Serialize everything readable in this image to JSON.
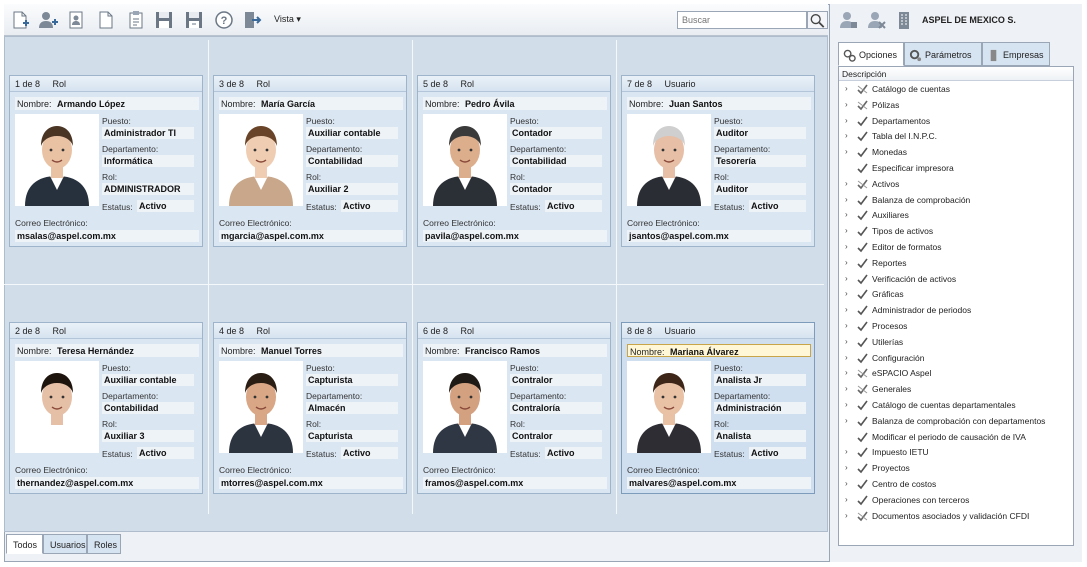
{
  "toolbar": {
    "icons": [
      "new-record-icon",
      "add-user-icon",
      "user-profile-icon",
      "blank-document-icon",
      "clipboard-icon",
      "save-icon",
      "save-as-icon",
      "help-icon",
      "exit-icon"
    ],
    "vista_label": "Vista",
    "search_placeholder": "Buscar"
  },
  "cards": [
    {
      "index": "1 de 8",
      "type": "Rol",
      "name": "Armando López",
      "puesto": "Administrador TI",
      "departamento": "Informática",
      "rol": "ADMINISTRADOR",
      "estatus": "Activo",
      "correo": "msalas@aspel.com.mx",
      "selected": false
    },
    {
      "index": "3 de 8",
      "type": "Rol",
      "name": "María García",
      "puesto": "Auxiliar contable",
      "departamento": "Contabilidad",
      "rol": "Auxiliar 2",
      "estatus": "Activo",
      "correo": "mgarcia@aspel.com.mx",
      "selected": false
    },
    {
      "index": "5 de 8",
      "type": "Rol",
      "name": "Pedro Ávila",
      "puesto": "Contador",
      "departamento": "Contabilidad",
      "rol": "Contador",
      "estatus": "Activo",
      "correo": "pavila@aspel.com.mx",
      "selected": false
    },
    {
      "index": "7 de 8",
      "type": "Usuario",
      "name": "Juan Santos",
      "puesto": "Auditor",
      "departamento": "Tesorería",
      "rol": "Auditor",
      "estatus": "Activo",
      "correo": "jsantos@aspel.com.mx",
      "selected": false
    },
    {
      "index": "2 de 8",
      "type": "Rol",
      "name": "Teresa Hernández",
      "puesto": "Auxiliar contable",
      "departamento": "Contabilidad",
      "rol": "Auxiliar 3",
      "estatus": "Activo",
      "correo": "thernandez@aspel.com.mx",
      "selected": false
    },
    {
      "index": "4 de 8",
      "type": "Rol",
      "name": "Manuel Torres",
      "puesto": "Capturista",
      "departamento": "Almacén",
      "rol": "Capturista",
      "estatus": "Activo",
      "correo": "mtorres@aspel.com.mx",
      "selected": false
    },
    {
      "index": "6 de 8",
      "type": "Rol",
      "name": "Francisco Ramos",
      "puesto": "Contralor",
      "departamento": "Contraloría",
      "rol": "Contralor",
      "estatus": "Activo",
      "correo": "framos@aspel.com.mx",
      "selected": false
    },
    {
      "index": "8 de 8",
      "type": "Usuario",
      "name": "Mariana Álvarez",
      "puesto": "Analista Jr",
      "departamento": "Administración",
      "rol": "Analista",
      "estatus": "Activo",
      "correo": "malvares@aspel.com.mx",
      "selected": true
    }
  ],
  "labels": {
    "nombre": "Nombre:",
    "puesto": "Puesto:",
    "departamento": "Departamento:",
    "rol": "Rol:",
    "estatus": "Estatus:",
    "correo": "Correo Electrónico:"
  },
  "bottom_tabs": [
    "Todos",
    "Usuarios",
    "Roles"
  ],
  "right_panel": {
    "company": "ASPEL DE MEXICO S.",
    "tabs": [
      "Opciones",
      "Parámetros",
      "Empresas"
    ],
    "tree_header": "Descripción",
    "tree_items": [
      {
        "label": "Catálogo de cuentas",
        "mark": "partial",
        "expandable": true
      },
      {
        "label": "Pólizas",
        "mark": "partial",
        "expandable": true
      },
      {
        "label": "Departamentos",
        "mark": "check",
        "expandable": true
      },
      {
        "label": "Tabla del I.N.P.C.",
        "mark": "check",
        "expandable": true
      },
      {
        "label": "Monedas",
        "mark": "check",
        "expandable": true
      },
      {
        "label": "Especificar impresora",
        "mark": "check",
        "expandable": false
      },
      {
        "label": "Activos",
        "mark": "partial",
        "expandable": true
      },
      {
        "label": "Balanza de comprobación",
        "mark": "check",
        "expandable": true
      },
      {
        "label": "Auxiliares",
        "mark": "check",
        "expandable": true
      },
      {
        "label": "Tipos de activos",
        "mark": "check",
        "expandable": true
      },
      {
        "label": "Editor de formatos",
        "mark": "check",
        "expandable": true
      },
      {
        "label": "Reportes",
        "mark": "check",
        "expandable": true
      },
      {
        "label": "Verificación de activos",
        "mark": "check",
        "expandable": true
      },
      {
        "label": "Gráficas",
        "mark": "check",
        "expandable": true
      },
      {
        "label": "Administrador de periodos",
        "mark": "check",
        "expandable": true
      },
      {
        "label": "Procesos",
        "mark": "check",
        "expandable": true
      },
      {
        "label": "Utilerías",
        "mark": "check",
        "expandable": true
      },
      {
        "label": "Configuración",
        "mark": "check",
        "expandable": true
      },
      {
        "label": "eSPACIO Aspel",
        "mark": "partial",
        "expandable": true
      },
      {
        "label": "Generales",
        "mark": "partial",
        "expandable": true
      },
      {
        "label": "Catálogo de cuentas departamentales",
        "mark": "check",
        "expandable": true
      },
      {
        "label": "Balanza de comprobación con departamentos",
        "mark": "check",
        "expandable": true
      },
      {
        "label": "Modificar el periodo de causación de  IVA",
        "mark": "check",
        "expandable": false
      },
      {
        "label": "Impuesto IETU",
        "mark": "check",
        "expandable": true
      },
      {
        "label": "Proyectos",
        "mark": "check",
        "expandable": true
      },
      {
        "label": "Centro de costos",
        "mark": "check",
        "expandable": true
      },
      {
        "label": "Operaciones con terceros",
        "mark": "check",
        "expandable": true
      },
      {
        "label": "Documentos asociados y validación CFDI",
        "mark": "partial",
        "expandable": true
      }
    ]
  },
  "colors": {
    "accent": "#2a5b8a",
    "card_bg": "#dae6f2",
    "selection": "#fff7d6"
  }
}
